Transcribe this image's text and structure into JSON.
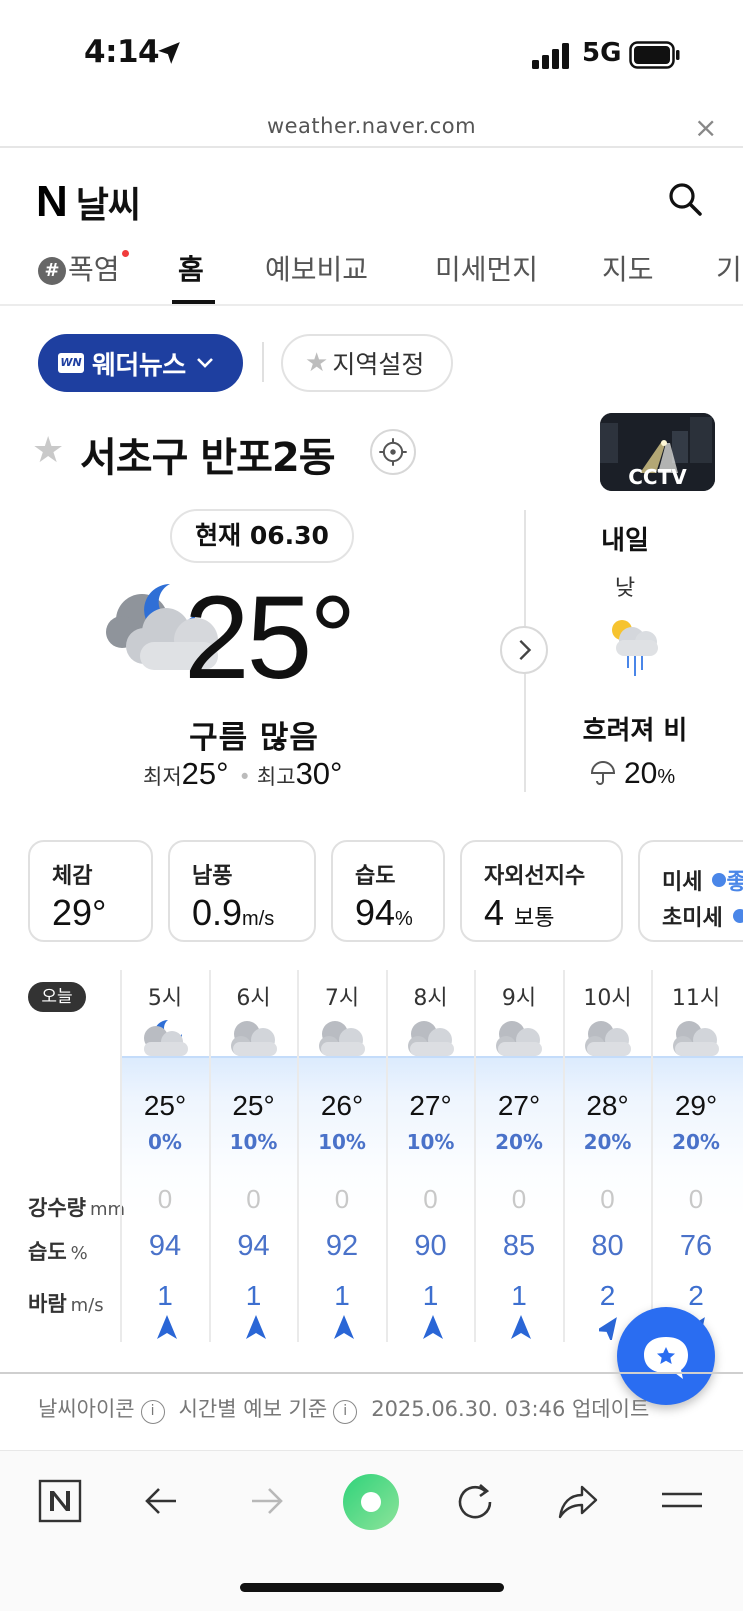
{
  "status": {
    "time": "4:14",
    "network": "5G"
  },
  "browser": {
    "url": "weather.naver.com"
  },
  "header": {
    "logo_letter": "N",
    "title": "날씨"
  },
  "nav": {
    "tabs": [
      "폭염",
      "홈",
      "예보비교",
      "미세먼지",
      "지도",
      "기"
    ],
    "active": "홈"
  },
  "chips": {
    "news": "웨더뉴스",
    "region": "지역설정"
  },
  "location": {
    "name": "서초구 반포2동",
    "cctv_label": "CCTV"
  },
  "current": {
    "badge": "현재 06.30",
    "temperature": "25°",
    "condition": "구름 많음",
    "min_label": "최저",
    "min_value": "25°",
    "max_label": "최고",
    "max_value": "30°"
  },
  "tomorrow": {
    "title": "내일",
    "period": "낮",
    "condition": "흐려져 비",
    "rain_value": "20",
    "rain_unit": "%"
  },
  "cards": {
    "feels": {
      "label": "체감",
      "value": "29°"
    },
    "wind": {
      "label": "남풍",
      "value": "0.9",
      "unit": "m/s"
    },
    "humidity": {
      "label": "습도",
      "value": "94",
      "unit": "%"
    },
    "uv": {
      "label": "자외선지수",
      "value": "4",
      "unit": "보통"
    },
    "dust": {
      "row1": "미세",
      "row1_tail": "좋",
      "row2": "초미세"
    }
  },
  "hourly": {
    "today_label": "오늘",
    "row_labels": {
      "rain": "강수량",
      "rain_unit": "mm",
      "humidity": "습도",
      "humidity_unit": "%",
      "wind": "바람",
      "wind_unit": "m/s"
    },
    "hours": [
      {
        "hour": "5시",
        "temp": "25°",
        "pop": "0%",
        "rain": "0",
        "humidity": "94",
        "wind": "1"
      },
      {
        "hour": "6시",
        "temp": "25°",
        "pop": "10%",
        "rain": "0",
        "humidity": "94",
        "wind": "1"
      },
      {
        "hour": "7시",
        "temp": "26°",
        "pop": "10%",
        "rain": "0",
        "humidity": "92",
        "wind": "1"
      },
      {
        "hour": "8시",
        "temp": "27°",
        "pop": "10%",
        "rain": "0",
        "humidity": "90",
        "wind": "1"
      },
      {
        "hour": "9시",
        "temp": "27°",
        "pop": "20%",
        "rain": "0",
        "humidity": "85",
        "wind": "1"
      },
      {
        "hour": "10시",
        "temp": "28°",
        "pop": "20%",
        "rain": "0",
        "humidity": "80",
        "wind": "2"
      },
      {
        "hour": "11시",
        "temp": "29°",
        "pop": "20%",
        "rain": "0",
        "humidity": "76",
        "wind": "2"
      }
    ]
  },
  "footer": {
    "icon_label": "날씨아이콘",
    "basis_label": "시간별 예보 기준",
    "updated": "2025.06.30. 03:46 업데이트"
  },
  "colors": {
    "accent": "#1e3fa0",
    "fab": "#2a6df1",
    "humidity_blue": "#4a72c9"
  }
}
